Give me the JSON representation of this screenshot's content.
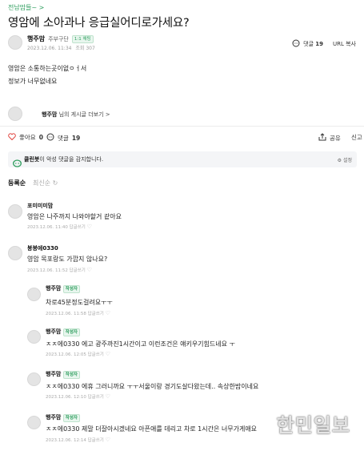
{
  "breadcrumb": "전남맘들~ >",
  "post": {
    "title": "영암에 소아과나 응급실어디로가세요?",
    "author": "행주맘",
    "author_role": "주부구단",
    "author_level": "1:1 채팅",
    "meta_date": "2023.12.06. 11:34",
    "meta_views": "조회 307",
    "comment_label": "댓글",
    "comment_count": "19",
    "url_copy": "URL 복사",
    "body_lines": [
      "영암은 소통하는곳이없ㅇㅓ서",
      "정보가 너무없네요"
    ],
    "more_posts_author": "행주맘",
    "more_posts_suffix": "님의 게시글 더보기 >",
    "like_label": "좋아요",
    "like_count": "0",
    "comment_action_label": "댓글",
    "comment_action_count": "19",
    "share_label": "공유",
    "report_label": "신고"
  },
  "cleanbot": {
    "name": "클린봇",
    "text": "이 악성 댓글을 감지합니다.",
    "settings": "설정"
  },
  "sort": {
    "active": "등록순",
    "inactive": "최신순"
  },
  "comments": [
    {
      "author": "포미미미맘",
      "badge": "",
      "text": "영암은 나주까지 나와야할거 같아요",
      "meta": "2023.12.06. 11:40 답글쓰기"
    },
    {
      "author": "봉봉에0330",
      "badge": "",
      "text": "영암 목포랑도 가깝지 않나요?",
      "meta": "2023.12.06. 11:52 답글쓰기"
    },
    {
      "author": "행주맘",
      "badge": "작성자",
      "text": "차로45분정도걸려요ㅜㅜ",
      "meta": "2023.12.06. 11:58 답글쓰기"
    },
    {
      "author": "행주맘",
      "badge": "작성자",
      "text": "ㅈㅈ에0330 에고 광주까진1시간이고 이런조건은 얘키우기힘드네요 ㅜ",
      "meta": "2023.12.06. 12:05 답글쓰기"
    },
    {
      "author": "행주맘",
      "badge": "작성자",
      "text": "ㅈㅈ에0330 에휴 그러니까요 ㅜㅜ서울이랑 경기도살다왔는데.. 속상한밤이네요",
      "meta": "2023.12.06. 12:10 답글쓰기"
    },
    {
      "author": "행주맘",
      "badge": "작성자",
      "text": "ㅈㅈ에0330 제말 더잘아시겠네요 아픈애를 데리고 차로 1시간은 너무가게애요",
      "meta": "2023.12.06. 12:14 답글쓰기"
    }
  ],
  "watermark": "한민일보",
  "colors": {
    "accent": "#2e9e5e",
    "like": "#e0403a"
  }
}
